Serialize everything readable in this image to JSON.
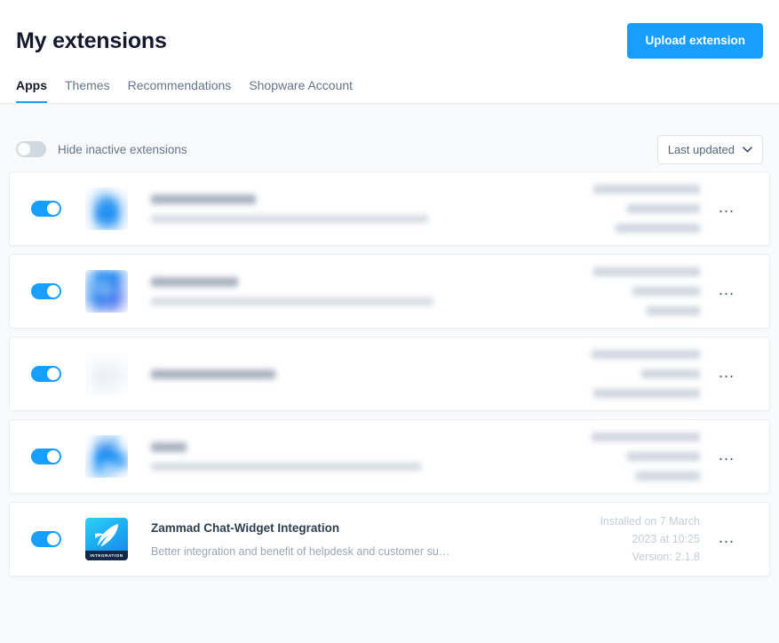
{
  "header": {
    "title": "My extensions",
    "upload_button": "Upload extension",
    "tabs": [
      {
        "label": "Apps",
        "active": true
      },
      {
        "label": "Themes",
        "active": false
      },
      {
        "label": "Recommendations",
        "active": false
      },
      {
        "label": "Shopware Account",
        "active": false
      }
    ]
  },
  "toolbar": {
    "hide_inactive_label": "Hide inactive extensions",
    "hide_inactive_on": false,
    "sort_value": "Last updated"
  },
  "colors": {
    "accent": "#189eff",
    "page_bg": "#f9fafb",
    "card_bg": "#ffffff",
    "title_text": "#16192b",
    "muted_text": "#64748b"
  },
  "icons": {
    "chevron_down": "chevron-down-icon",
    "overflow_menu": "…",
    "zammad_badge": "INTEGRATION"
  },
  "extensions": [
    {
      "enabled": true,
      "redacted": true,
      "icon_kind": "blurred-blue-tall",
      "name": "",
      "description": "",
      "meta_lines": [
        "",
        "",
        ""
      ],
      "title_bar_w": 118,
      "desc_bar_w": 312,
      "meta_bar_w": [
        120,
        82,
        95
      ]
    },
    {
      "enabled": true,
      "redacted": true,
      "icon_kind": "blurred-blue-block",
      "name": "",
      "description": "",
      "meta_lines": [
        "",
        "",
        ""
      ],
      "title_bar_w": 98,
      "desc_bar_w": 318,
      "meta_bar_w": [
        120,
        76,
        60
      ]
    },
    {
      "enabled": true,
      "redacted": true,
      "icon_kind": "blurred-white",
      "name": "",
      "description": "",
      "meta_lines": [
        "",
        "",
        ""
      ],
      "title_bar_w": 140,
      "desc_bar_w": 0,
      "meta_bar_w": [
        122,
        66,
        120
      ]
    },
    {
      "enabled": true,
      "redacted": true,
      "icon_kind": "blurred-blue-small",
      "name": "",
      "description": "",
      "meta_lines": [
        "",
        "",
        ""
      ],
      "title_bar_w": 40,
      "desc_bar_w": 304,
      "meta_bar_w": [
        122,
        82,
        72
      ]
    },
    {
      "enabled": true,
      "redacted": false,
      "icon_kind": "zammad",
      "name": "Zammad Chat-Widget Integration",
      "description": "Better integration and benefit of helpdesk and customer su…",
      "meta_lines": [
        "Installed on 7 March",
        "2023 at 10:25",
        "Version: 2.1.8"
      ]
    }
  ]
}
